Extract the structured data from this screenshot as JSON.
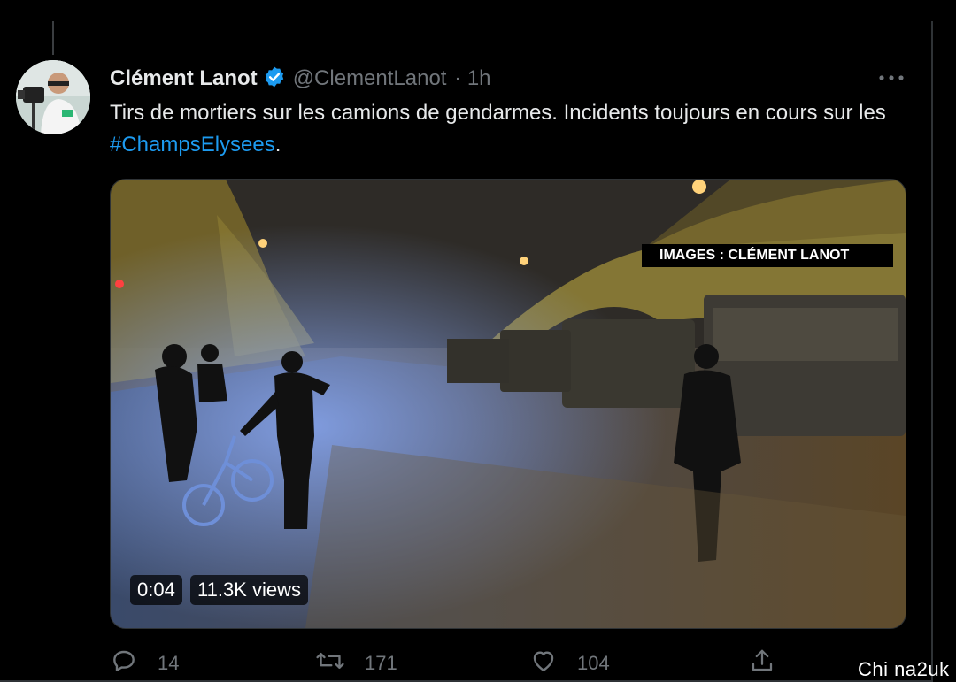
{
  "tweet": {
    "author_name": "Clément Lanot",
    "handle": "@ClementLanot",
    "time": "· 1h",
    "text_before": "Tirs de mortiers sur les camions de gendarmes. Incidents toujours en cours sur les ",
    "hashtag": "#ChampsElysees",
    "text_after": ".",
    "icons": {
      "verified": "verified-badge-icon",
      "more": "more-options-icon"
    }
  },
  "media": {
    "overlay_label": "IMAGES : CLÉMENT LANOT",
    "duration": "0:04",
    "views": "11.3K views"
  },
  "actions": {
    "reply_count": "14",
    "retweet_count": "171",
    "like_count": "104"
  },
  "colors": {
    "accent": "#1d9bf0",
    "muted": "#71767b",
    "background": "#000000"
  },
  "watermark": "Chi na2uk"
}
